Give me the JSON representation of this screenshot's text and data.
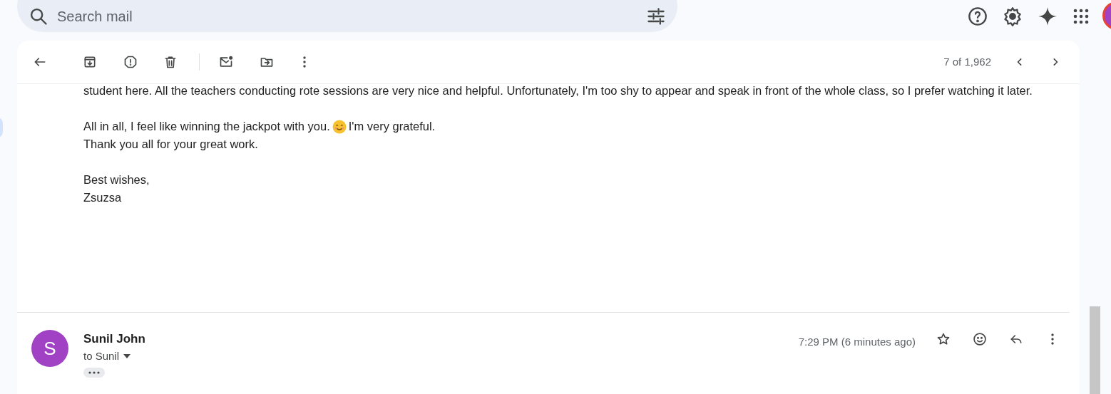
{
  "search": {
    "placeholder": "Search mail"
  },
  "toolbar": {
    "counter": "7 of 1,962"
  },
  "body": {
    "lines": [
      {
        "kind": "text",
        "text": "student here. All the teachers conducting rote sessions are very nice and helpful. Unfortunately, I'm too shy to appear and speak in front of the whole class, so I prefer watching it later."
      },
      {
        "kind": "gap"
      },
      {
        "kind": "emoji",
        "before": "All in all, I feel like winning the jackpot with you.",
        "after": "I'm very grateful."
      },
      {
        "kind": "text",
        "text": "Thank you all for your great work."
      },
      {
        "kind": "gap"
      },
      {
        "kind": "text",
        "text": "Best wishes,"
      },
      {
        "kind": "text",
        "text": "Zsuzsa"
      }
    ]
  },
  "message": {
    "avatar_letter": "S",
    "sender": "Sunil John",
    "recipient": "to Sunil",
    "time": "7:29 PM (6 minutes ago)",
    "starred": false
  }
}
